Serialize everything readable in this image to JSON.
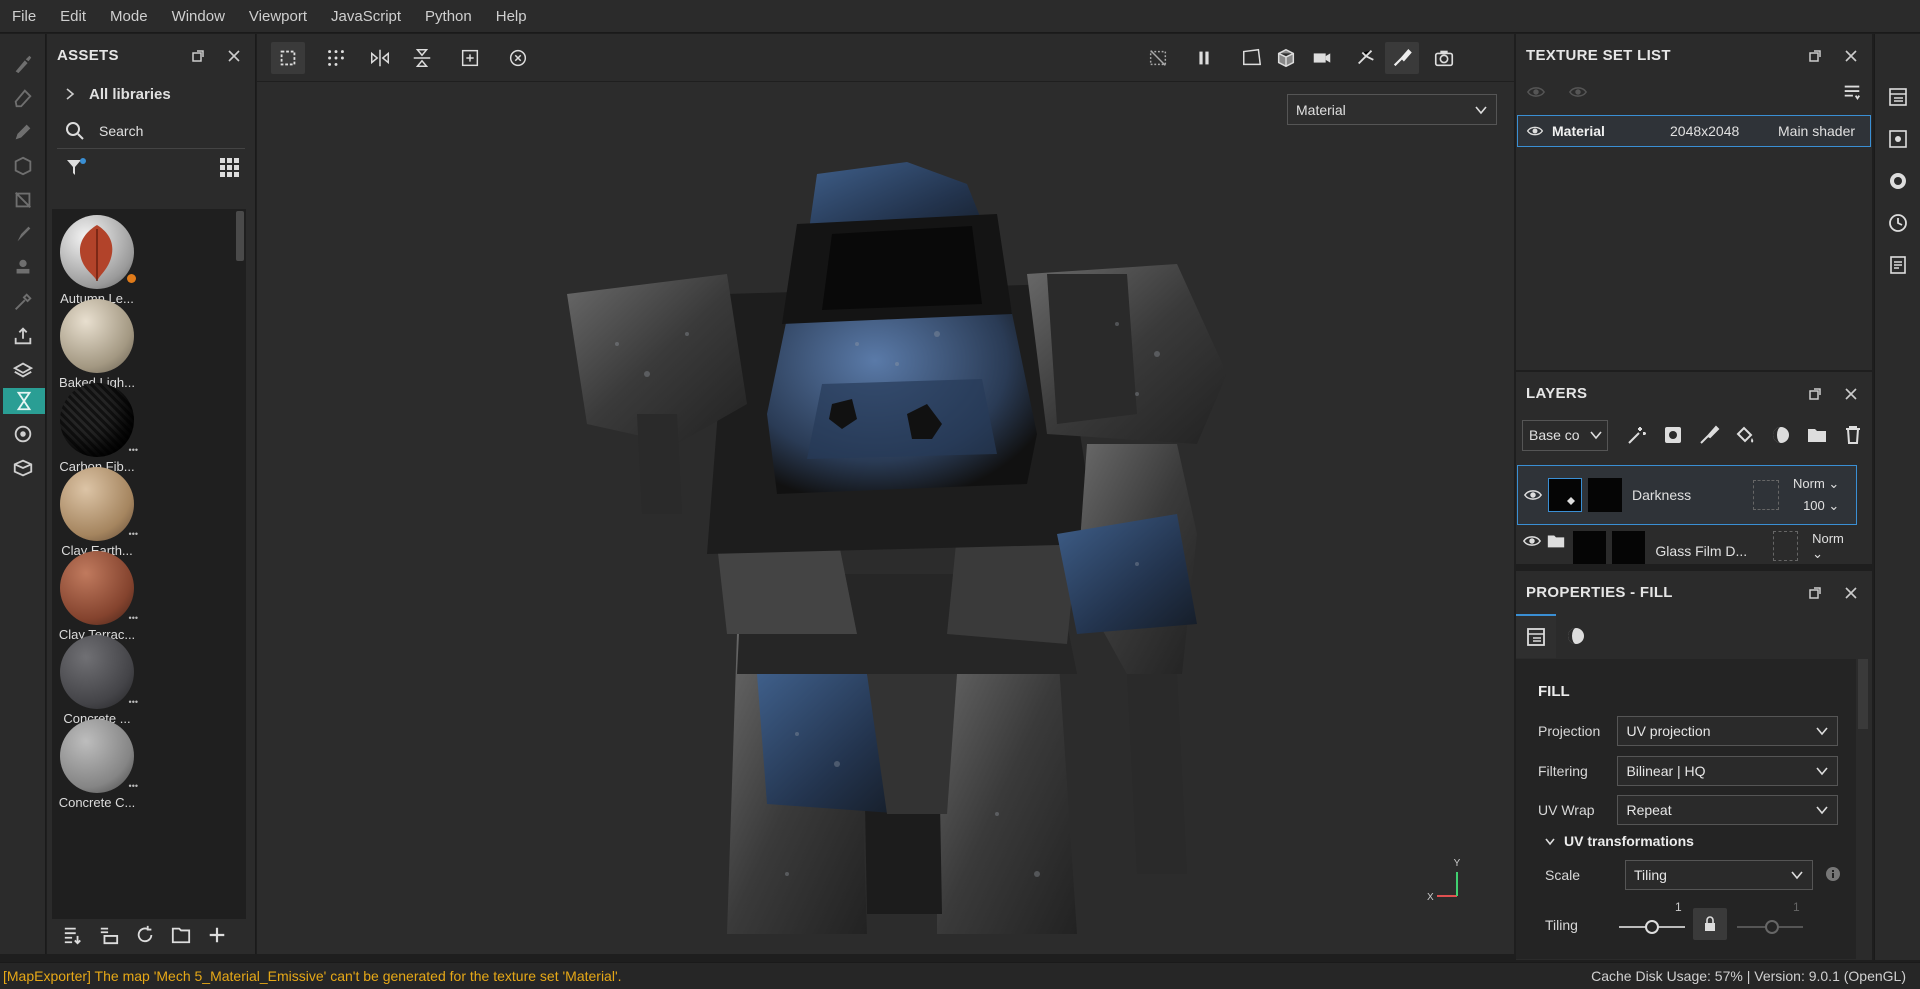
{
  "menu": [
    "File",
    "Edit",
    "Mode",
    "Window",
    "Viewport",
    "JavaScript",
    "Python",
    "Help"
  ],
  "assets": {
    "title": "ASSETS",
    "library": "All libraries",
    "search_placeholder": "Search",
    "items": [
      {
        "name": "Autumn Le...",
        "color": "#c9c9c9"
      },
      {
        "name": "Baked Ligh...",
        "color": "#b8ad98"
      },
      {
        "name": "Carbon Fib...",
        "color": "#1b1b1b"
      },
      {
        "name": "Clay Earth...",
        "color": "#a88a6c"
      },
      {
        "name": "Clay Terrac...",
        "color": "#8a4a36"
      },
      {
        "name": "Concrete ...",
        "color": "#4a4a4c"
      },
      {
        "name": "Concrete C...",
        "color": "#8a8a8a"
      }
    ]
  },
  "viewport": {
    "material_select": "Material",
    "gizmo": {
      "x": "X",
      "y": "Y"
    }
  },
  "texture_set_list": {
    "title": "TEXTURE SET LIST",
    "row": {
      "name": "Material",
      "resolution": "2048x2048",
      "shader": "Main shader"
    }
  },
  "layers": {
    "title": "LAYERS",
    "channel": "Base co",
    "items": [
      {
        "name": "Darkness",
        "blend": "Norm",
        "opacity": "100"
      },
      {
        "name": "Glass Film D...",
        "blend": "Norm"
      }
    ]
  },
  "properties": {
    "title": "PROPERTIES - FILL",
    "section": "FILL",
    "rows": [
      {
        "label": "Projection",
        "value": "UV projection"
      },
      {
        "label": "Filtering",
        "value": "Bilinear | HQ"
      },
      {
        "label": "UV Wrap",
        "value": "Repeat"
      }
    ],
    "uv_transformations": "UV transformations",
    "scale_label": "Scale",
    "scale_value": "Tiling",
    "tiling_label": "Tiling",
    "tiling_value_1": "1",
    "tiling_value_2": "1"
  },
  "status": {
    "message": "[MapExporter] The map 'Mech 5_Material_Emissive' can't be generated for the texture set 'Material'.",
    "info": "Cache Disk Usage:   57% | Version: 9.0.1 (OpenGL)"
  },
  "colors": {
    "accent": "#3a8fd4",
    "active_tool": "#2a9e94",
    "warning": "#e6a817"
  }
}
